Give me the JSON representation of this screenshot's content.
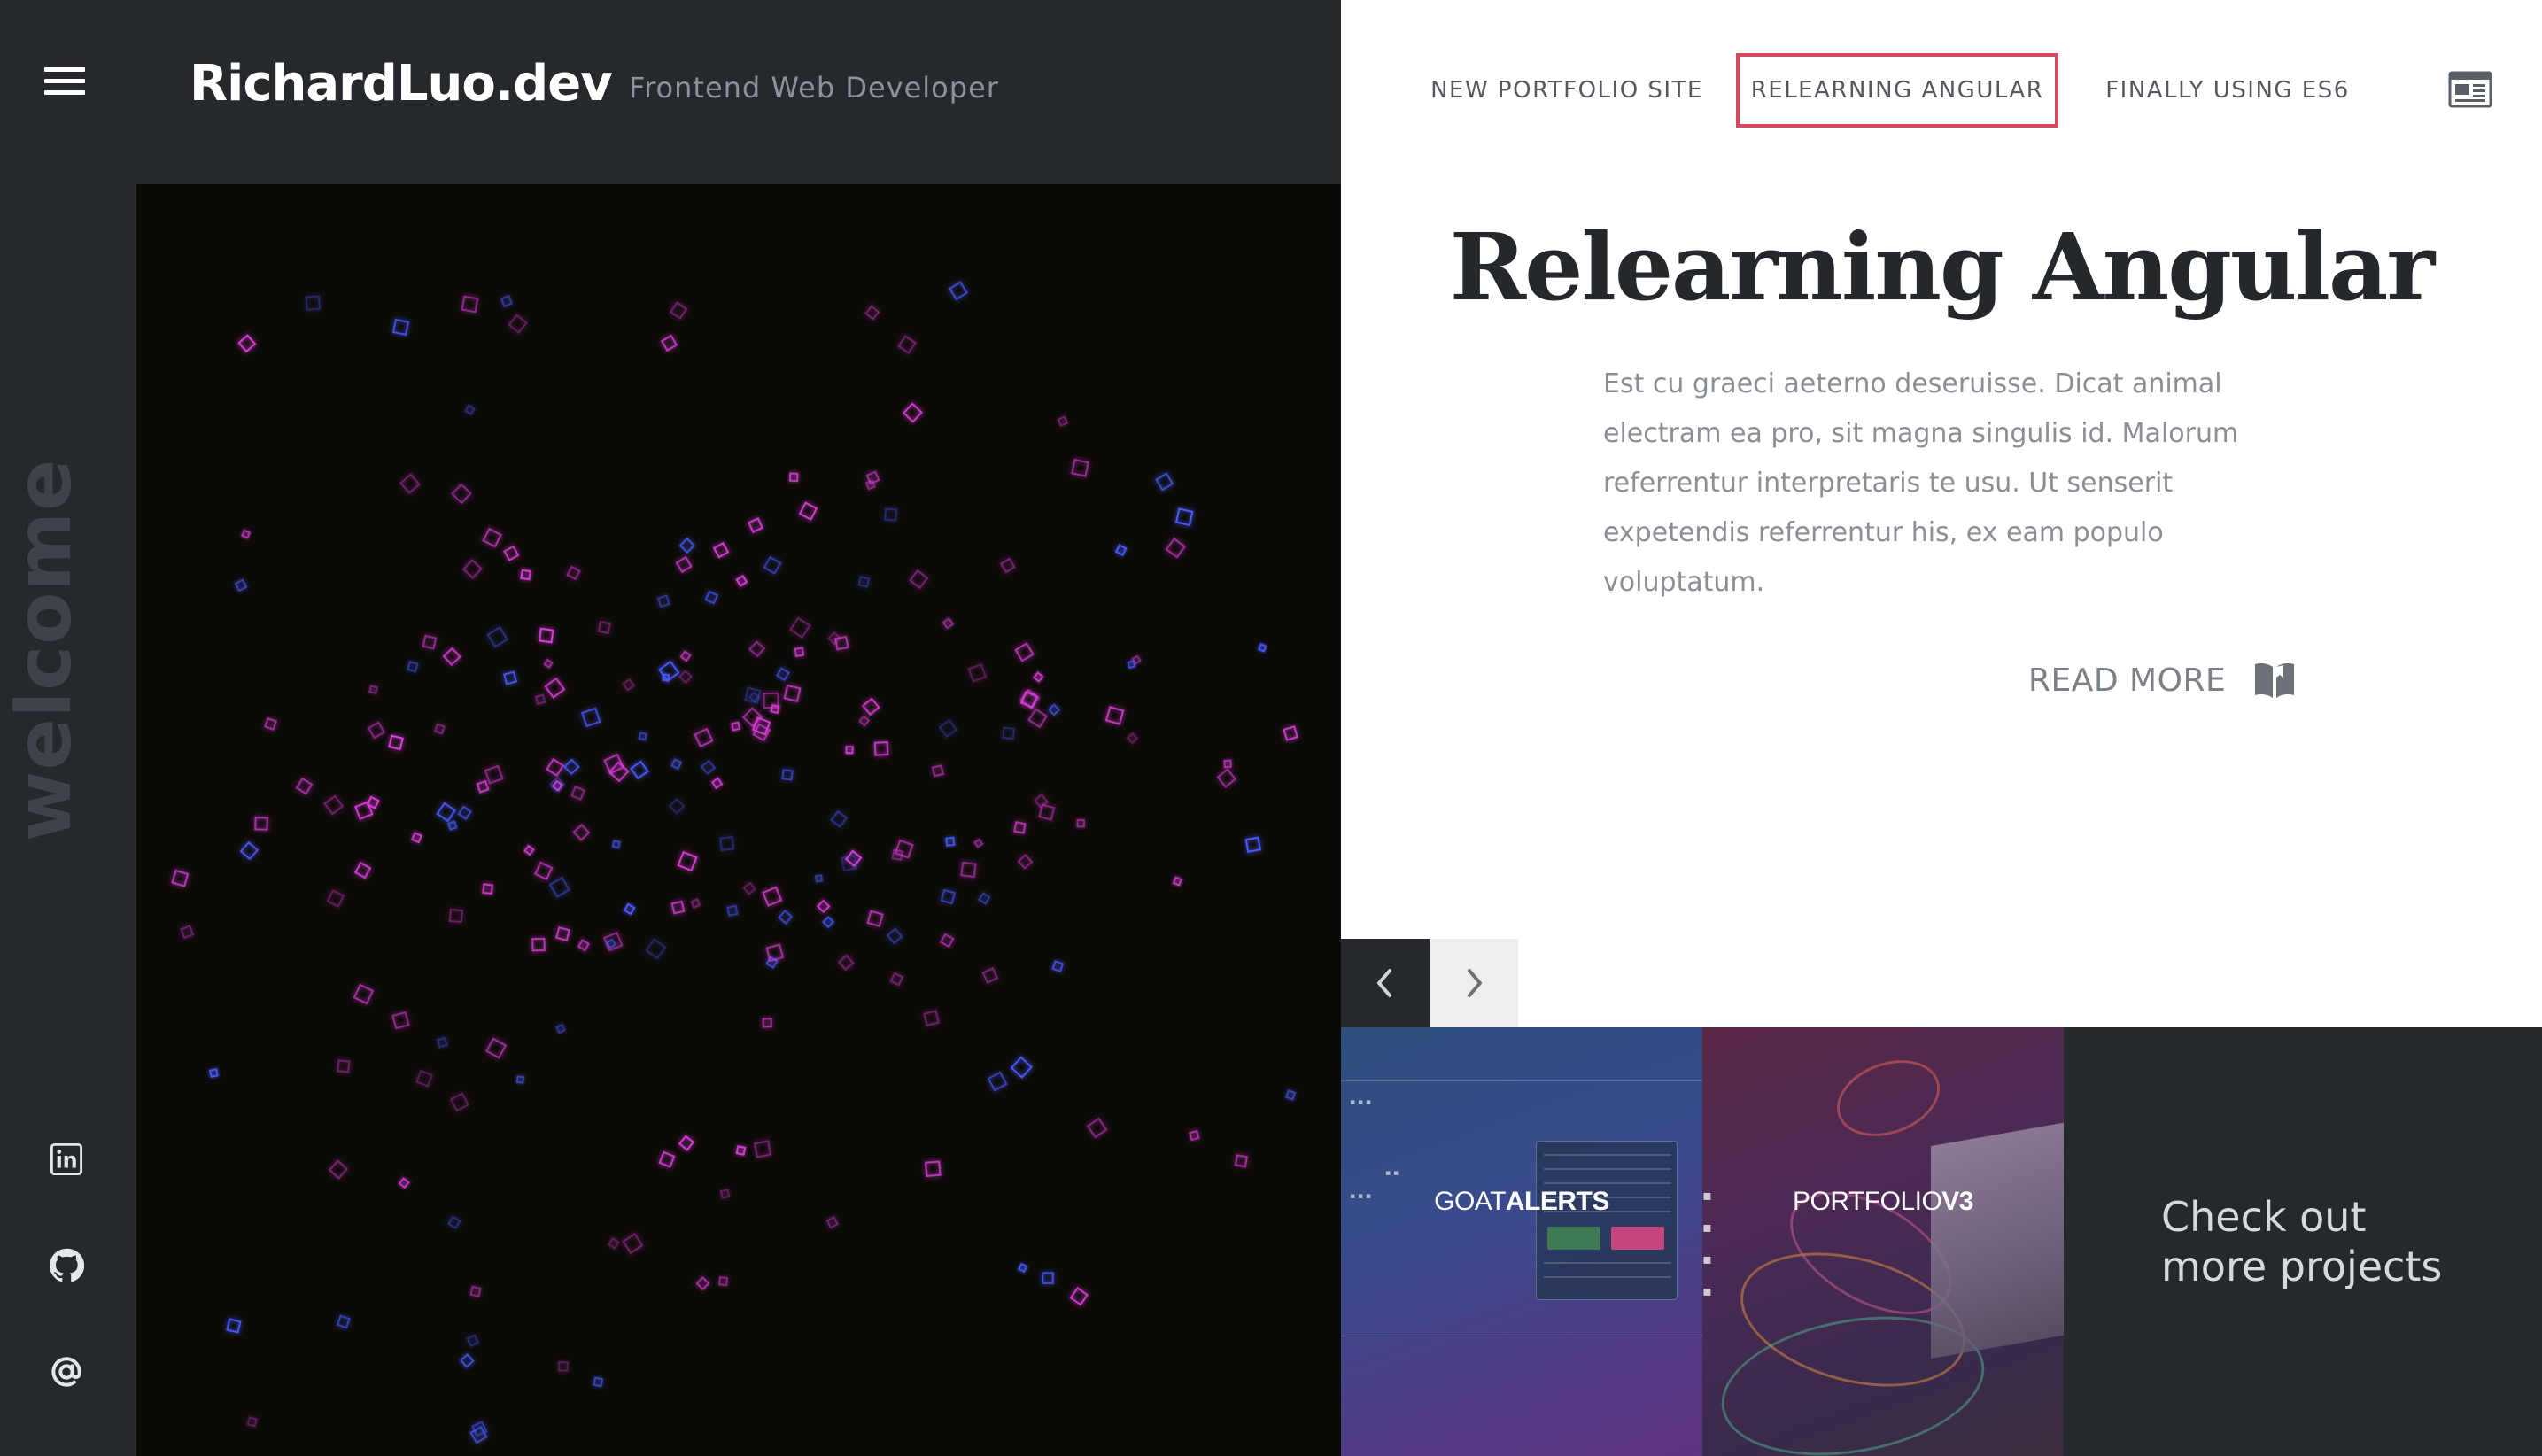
{
  "site": {
    "brand": "RichardLuo.dev",
    "tagline": "Frontend Web Developer",
    "side_label": "welcome"
  },
  "tabs": [
    {
      "label": "NEW PORTFOLIO SITE",
      "active": false
    },
    {
      "label": "RELEARNING ANGULAR",
      "active": true
    },
    {
      "label": "FINALLY USING ES6",
      "active": false
    }
  ],
  "post": {
    "title": "Relearning Angular",
    "body": "Est cu graeci aeterno deseruisse. Dicat animal electram ea pro, sit magna singulis id. Malorum referrentur interpretaris te usu. Ut senserit expetendis referrentur his, ex eam populo voluptatum.",
    "read_more": "READ MORE"
  },
  "projects": {
    "goat": {
      "title_thin": "GOAT",
      "title_bold": "ALERTS"
    },
    "portfolio": {
      "title_thin": "PORTFOLIO",
      "title_bold": "V3"
    },
    "more": "Check out\nmore projects"
  },
  "colors": {
    "dark": "#25292e",
    "accent": "#d24a5e",
    "particle_magenta": "#e040e0",
    "particle_blue": "#4a5cff"
  },
  "icons": {
    "menu": "hamburger-icon",
    "linkedin": "linkedin-icon",
    "github": "github-icon",
    "email": "at-sign-icon",
    "news": "newspaper-icon",
    "book": "book-icon"
  }
}
